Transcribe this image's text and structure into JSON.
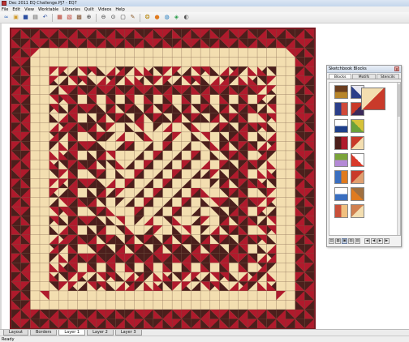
{
  "window": {
    "title": "Dec 2011 EQ Challenge.PJ7 - EQ7"
  },
  "menubar": {
    "items": [
      "File",
      "Edit",
      "View",
      "Worktable",
      "Libraries",
      "Quilt",
      "Videos",
      "Help"
    ]
  },
  "toolbar": {
    "buttons": [
      {
        "name": "new-project-icon",
        "glyph": "≈",
        "color": "#3a6fc0"
      },
      {
        "name": "open-project-icon",
        "glyph": "▣",
        "color": "#d19a2a"
      },
      {
        "name": "save-project-icon",
        "glyph": "■",
        "color": "#2d4fa1"
      },
      {
        "name": "print-icon",
        "glyph": "▤",
        "color": "#555555"
      },
      {
        "name": "undo-icon",
        "glyph": "↶",
        "color": "#2d4fa1"
      },
      {
        "name": "worktable-quilt-icon",
        "glyph": "▦",
        "color": "#b4301f"
      },
      {
        "name": "library-icon",
        "glyph": "▧",
        "color": "#c0392b"
      },
      {
        "name": "fabric-icon",
        "glyph": "▩",
        "color": "#7b4b2a"
      },
      {
        "name": "zoom-in-icon",
        "glyph": "⊕",
        "color": "#333333"
      },
      {
        "name": "zoom-out-icon",
        "glyph": "⊖",
        "color": "#333333"
      },
      {
        "name": "zoom-fit-icon",
        "glyph": "⊙",
        "color": "#333333"
      },
      {
        "name": "fit-to-worktable-icon",
        "glyph": "▢",
        "color": "#333333"
      },
      {
        "name": "paintbrush-icon",
        "glyph": "✎",
        "color": "#8a5a2b"
      },
      {
        "name": "spraycan-icon",
        "glyph": "❂",
        "color": "#b8860b"
      },
      {
        "name": "color-wheel-icon",
        "glyph": "●",
        "color": "#e07b1f"
      },
      {
        "name": "globe-icon",
        "glyph": "◍",
        "color": "#1f7bc0"
      },
      {
        "name": "color-picker-icon",
        "glyph": "◈",
        "color": "#2a9d4a"
      },
      {
        "name": "info-icon",
        "glyph": "◐",
        "color": "#555555"
      }
    ]
  },
  "quilt": {
    "colors": {
      "background": "#f3deb0",
      "red": "#b01a2c",
      "brown": "#4b1f1c",
      "grid": "#6a4a3a",
      "border": "#7a1620"
    }
  },
  "sketchbook": {
    "title": "Sketchbook Blocks",
    "tabs": [
      "Blocks",
      "Motifs",
      "Stencils"
    ],
    "active_tab": "Blocks",
    "close_glyph": "x",
    "bottom_buttons": [
      "▤",
      "▦",
      "▣",
      "▧",
      "▨",
      "◀",
      "◀",
      "▶",
      "▶"
    ]
  },
  "bottom_tabs": {
    "items": [
      "Layout",
      "Borders",
      "Layer 1",
      "Layer 2",
      "Layer 3"
    ],
    "active": "Layer 1"
  },
  "status": {
    "text": "Ready"
  }
}
